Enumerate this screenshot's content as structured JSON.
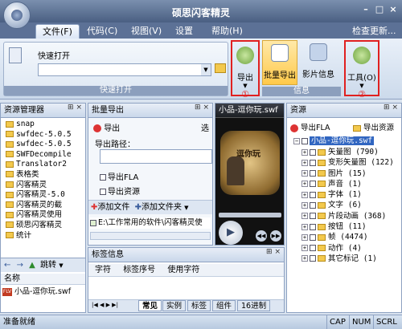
{
  "window": {
    "title": "硕思闪客精灵",
    "min": "–",
    "max": "□",
    "close": "×"
  },
  "menus": [
    "文件(F)",
    "代码(C)",
    "视图(V)",
    "设置",
    "帮助(H)"
  ],
  "check_update": "检查更新...",
  "ribbon": {
    "quick_open_label": "快速打开",
    "quick_open_group": "快速打开",
    "export_label": "导出",
    "batch_export_label": "批量导出",
    "movie_info_label": "影片信息",
    "info_group": "信息",
    "tools_label": "工具(O)",
    "marker1": "①",
    "marker2": "②"
  },
  "resource_manager": {
    "title": "资源管理器",
    "items": [
      "snap",
      "swfdec-5.0.5",
      "swfdec-5.0.5",
      "SWFDecompile",
      "Translator2",
      "表格类",
      "闪客精灵",
      "闪客精灵-5.0",
      "闪客精灵的截",
      "闪客精灵使用",
      "硕思闪客精灵",
      "统计"
    ],
    "jump": "跳转",
    "col_name": "名称",
    "file": "小品-逗你玩.swf"
  },
  "batch_export": {
    "title": "批量导出",
    "export_btn": "导出",
    "option": "选",
    "path_label": "导出路径：",
    "path_value": "",
    "export_fla": "导出FLA",
    "export_res": "导出资源",
    "add_file": "添加文件",
    "add_folder": "添加文件夹",
    "file_entry": "E:\\工作常用的软件\\闪客精灵使"
  },
  "preview": {
    "title": "小品-逗你玩.swf",
    "poster_text": "逗你玩"
  },
  "tag_info": {
    "title": "标签信息",
    "cols": [
      "字符",
      "标签序号",
      "使用字符"
    ],
    "tabs": [
      "常见",
      "实例",
      "标签",
      "组件",
      "16进制"
    ]
  },
  "resources": {
    "title": "资源",
    "export_fla": "导出FLA",
    "export_res": "导出资源",
    "root": "小品-逗你玩.swf",
    "items": [
      "矢量图 (790)",
      "变形矢量图 (122)",
      "图片 (15)",
      "声音 (1)",
      "字体 (1)",
      "文字 (6)",
      "片段动画 (368)",
      "按钮 (11)",
      "帧 (4474)",
      "动作 (4)",
      "其它标记 (1)"
    ]
  },
  "statusbar": {
    "text": "准备就绪",
    "caps": "CAP",
    "num": "NUM",
    "scrl": "SCRL"
  }
}
